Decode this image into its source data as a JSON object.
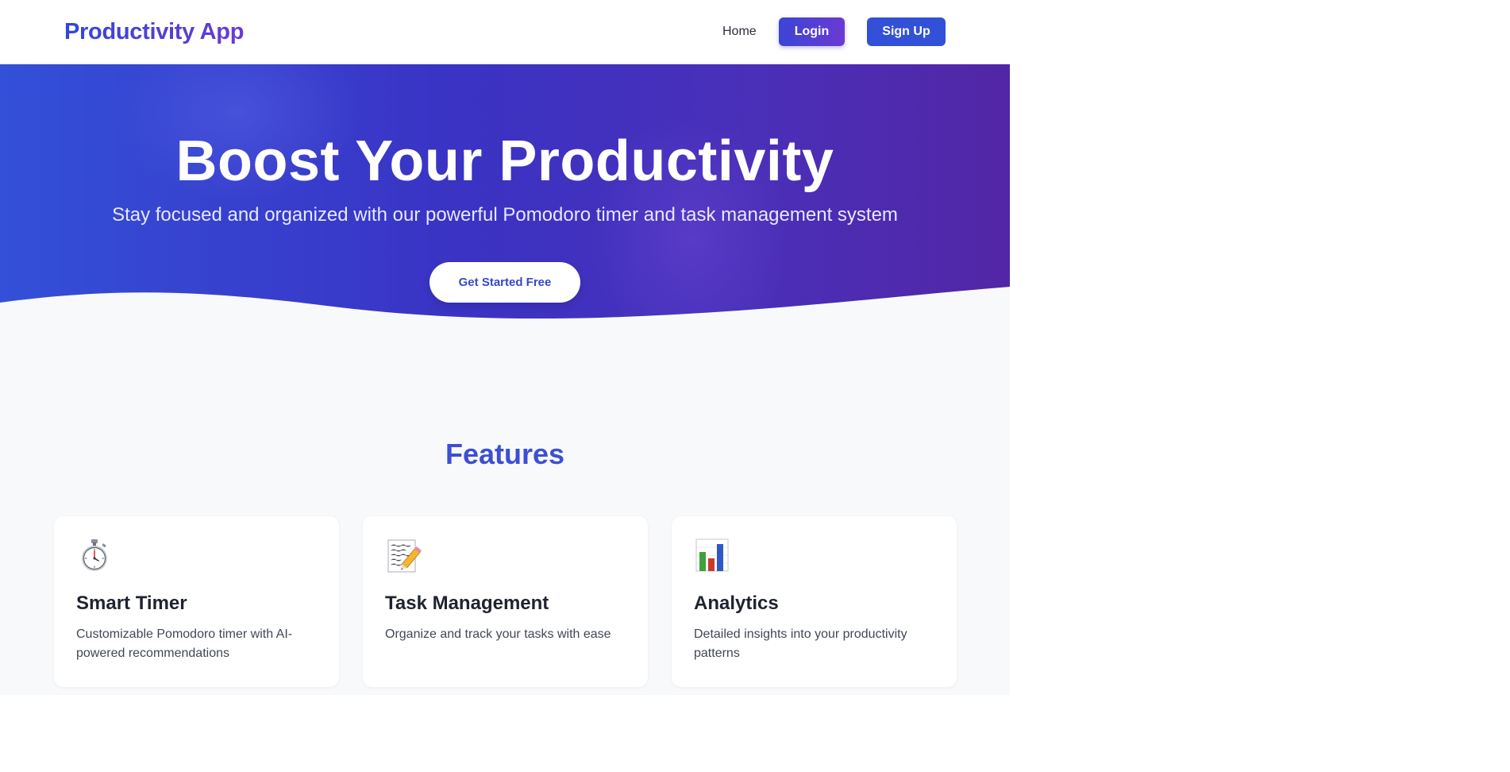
{
  "header": {
    "brand": "Productivity App",
    "nav": {
      "home": "Home",
      "login": "Login",
      "signup": "Sign Up"
    }
  },
  "hero": {
    "title": "Boost Your Productivity",
    "subtitle": "Stay focused and organized with our powerful Pomodoro timer and task management system",
    "cta": "Get Started Free"
  },
  "features": {
    "title": "Features",
    "items": [
      {
        "icon": "stopwatch-icon",
        "title": "Smart Timer",
        "description": "Customizable Pomodoro timer with AI-powered recommendations"
      },
      {
        "icon": "memo-icon",
        "title": "Task Management",
        "description": "Organize and track your tasks with ease"
      },
      {
        "icon": "bar-chart-icon",
        "title": "Analytics",
        "description": "Detailed insights into your productivity patterns"
      }
    ]
  },
  "colors": {
    "primary": "#3350d8",
    "accent": "#6b3ad3",
    "background": "#f8f9fb",
    "text": "#1f2330"
  }
}
